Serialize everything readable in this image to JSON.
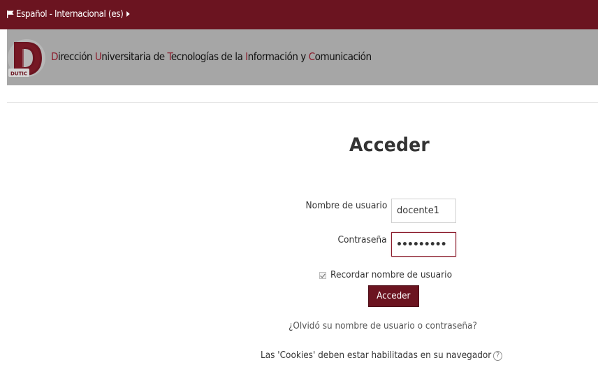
{
  "topbar": {
    "language_label": "Español - Internacional (es)",
    "flag_icon": "flag-icon",
    "caret_icon": "caret-right-icon"
  },
  "banner": {
    "logo_text": "DUTIC",
    "title_parts": [
      {
        "text": "D",
        "highlight": true
      },
      {
        "text": "irección ",
        "highlight": false
      },
      {
        "text": "U",
        "highlight": true
      },
      {
        "text": "niversitaria de ",
        "highlight": false
      },
      {
        "text": "T",
        "highlight": true
      },
      {
        "text": "ecnologías de la ",
        "highlight": false
      },
      {
        "text": "I",
        "highlight": true
      },
      {
        "text": "nformación y ",
        "highlight": false
      },
      {
        "text": "C",
        "highlight": true
      },
      {
        "text": "omunicación",
        "highlight": false
      }
    ]
  },
  "login": {
    "heading": "Acceder",
    "username_label": "Nombre de usuario",
    "username_value": "docente1",
    "password_label": "Contraseña",
    "password_mask": "•••••••••",
    "remember_label": "Recordar nombre de usuario",
    "remember_checked": true,
    "submit_label": "Acceder",
    "forgot_link": "¿Olvidó su nombre de usuario o contraseña?",
    "cookies_notice": "Las 'Cookies' deben estar habilitadas en su navegador",
    "help_icon": "question-circle-icon"
  },
  "colors": {
    "brand": "#6b1420",
    "banner_bg": "#a6a6a6",
    "highlight": "#8b1c2c"
  }
}
